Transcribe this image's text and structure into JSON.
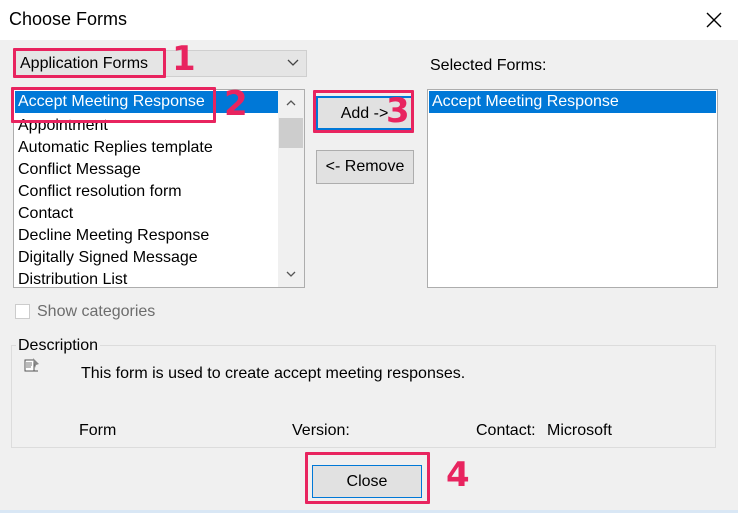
{
  "window": {
    "title": "Choose Forms",
    "close_icon": "close-icon"
  },
  "forms_source": {
    "selected_value": "Application Forms"
  },
  "available_forms": {
    "items": [
      "Accept Meeting Response",
      "Appointment",
      "Automatic Replies template",
      "Conflict Message",
      "Conflict resolution form",
      "Contact",
      "Decline Meeting Response",
      "Digitally Signed Message",
      "Distribution List"
    ],
    "selected_index": 0
  },
  "buttons": {
    "add": "Add ->",
    "remove": "<- Remove",
    "close": "Close"
  },
  "selected_forms": {
    "label": "Selected Forms:",
    "items": [
      "Accept Meeting Response"
    ]
  },
  "show_categories": {
    "label": "Show categories",
    "checked": false,
    "enabled": false
  },
  "description": {
    "legend": "Description",
    "text": "This form is used to create accept meeting responses.",
    "form_label": "Form",
    "version_label": "Version:",
    "contact_label": "Contact:",
    "contact_value": "Microsoft"
  },
  "annotations": {
    "color": "#e8245f",
    "steps": [
      "1",
      "2",
      "3",
      "4"
    ]
  },
  "colors": {
    "selection": "#0078d7",
    "dialog_bg": "#f0f0f0"
  }
}
